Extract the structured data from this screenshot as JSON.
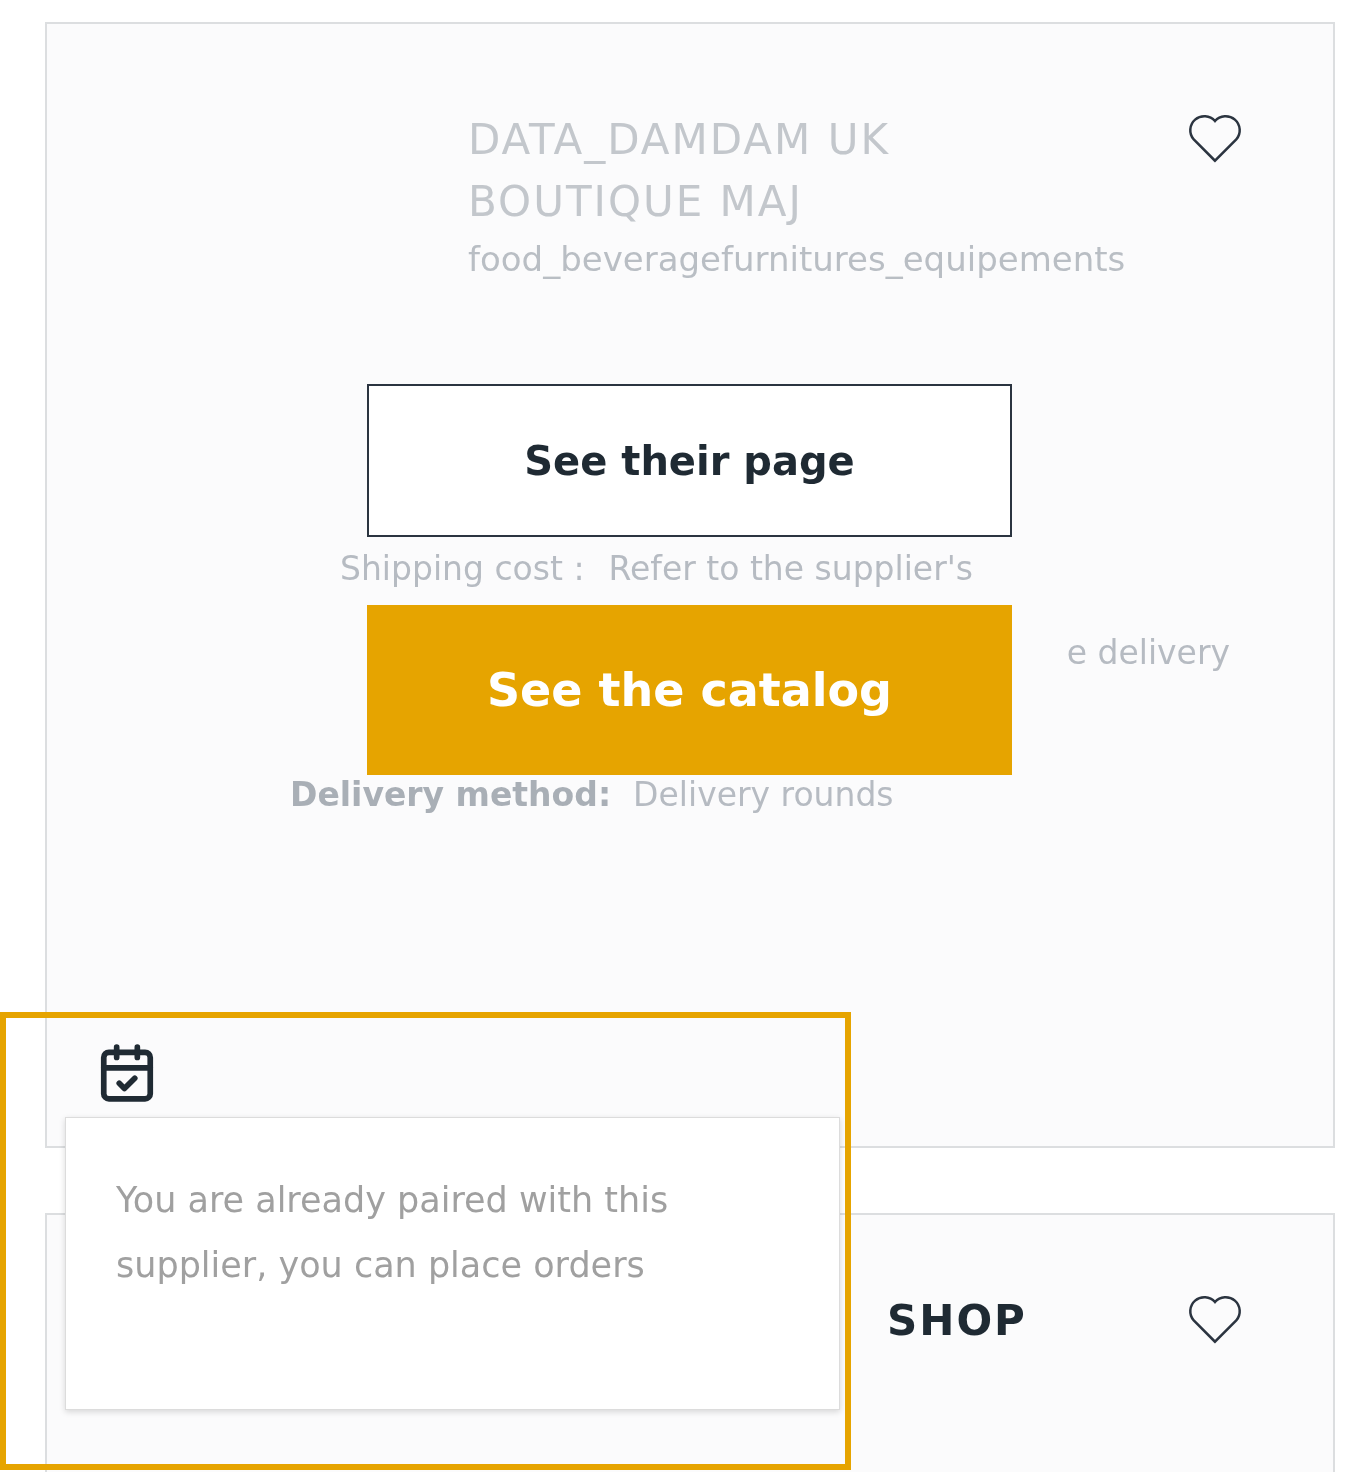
{
  "supplier_card": {
    "title": "DATA_DAMDAM UK BOUTIQUE MAJ",
    "category": "food_beveragefurnitures_equipements",
    "favorite": false,
    "buttons": [
      {
        "kind": "outline",
        "label": "See their page"
      },
      {
        "kind": "primary",
        "label": "See the catalog"
      }
    ],
    "shipping": {
      "label": "Shipping cost :",
      "value": "Refer to the supplier's",
      "continuation": "e delivery"
    },
    "delivery": {
      "label": "Delivery method:",
      "value": "Delivery rounds"
    }
  },
  "tooltip": {
    "text": "You are already paired with this supplier, you can place orders"
  },
  "next_card": {
    "title": "SHOP",
    "favorite": false
  }
}
